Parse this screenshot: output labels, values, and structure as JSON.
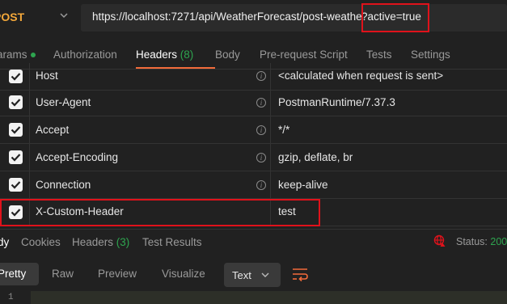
{
  "request": {
    "method": "POST",
    "url_path": "https://localhost:7271/api/WeatherForecast/post-weather",
    "url_query": "?active=true"
  },
  "request_tabs": {
    "params": "arams",
    "authorization": "Authorization",
    "headers": "Headers",
    "headers_count": "(8)",
    "body": "Body",
    "prerequest": "Pre-request Script",
    "tests": "Tests",
    "settings": "Settings"
  },
  "headers": [
    {
      "key": "Host",
      "value": "<calculated when request is sent>",
      "checked": true
    },
    {
      "key": "User-Agent",
      "value": "PostmanRuntime/7.37.3",
      "checked": true
    },
    {
      "key": "Accept",
      "value": "*/*",
      "checked": true
    },
    {
      "key": "Accept-Encoding",
      "value": "gzip, deflate, br",
      "checked": true
    },
    {
      "key": "Connection",
      "value": "keep-alive",
      "checked": true
    },
    {
      "key": "X-Custom-Header",
      "value": "test",
      "checked": true
    }
  ],
  "response_tabs": {
    "body": "dy",
    "cookies": "Cookies",
    "headers": "Headers",
    "headers_count": "(3)",
    "test_results": "Test Results"
  },
  "status": {
    "label": "Status:",
    "value": "200"
  },
  "format": {
    "pretty": "Pretty",
    "raw": "Raw",
    "preview": "Preview",
    "visualize": "Visualize",
    "type": "Text"
  },
  "editor": {
    "line_number": "1"
  },
  "colors": {
    "method": "#f4a83a",
    "accent": "#f26b3a",
    "success": "#2ea44f",
    "highlight_border": "#e0121b"
  }
}
